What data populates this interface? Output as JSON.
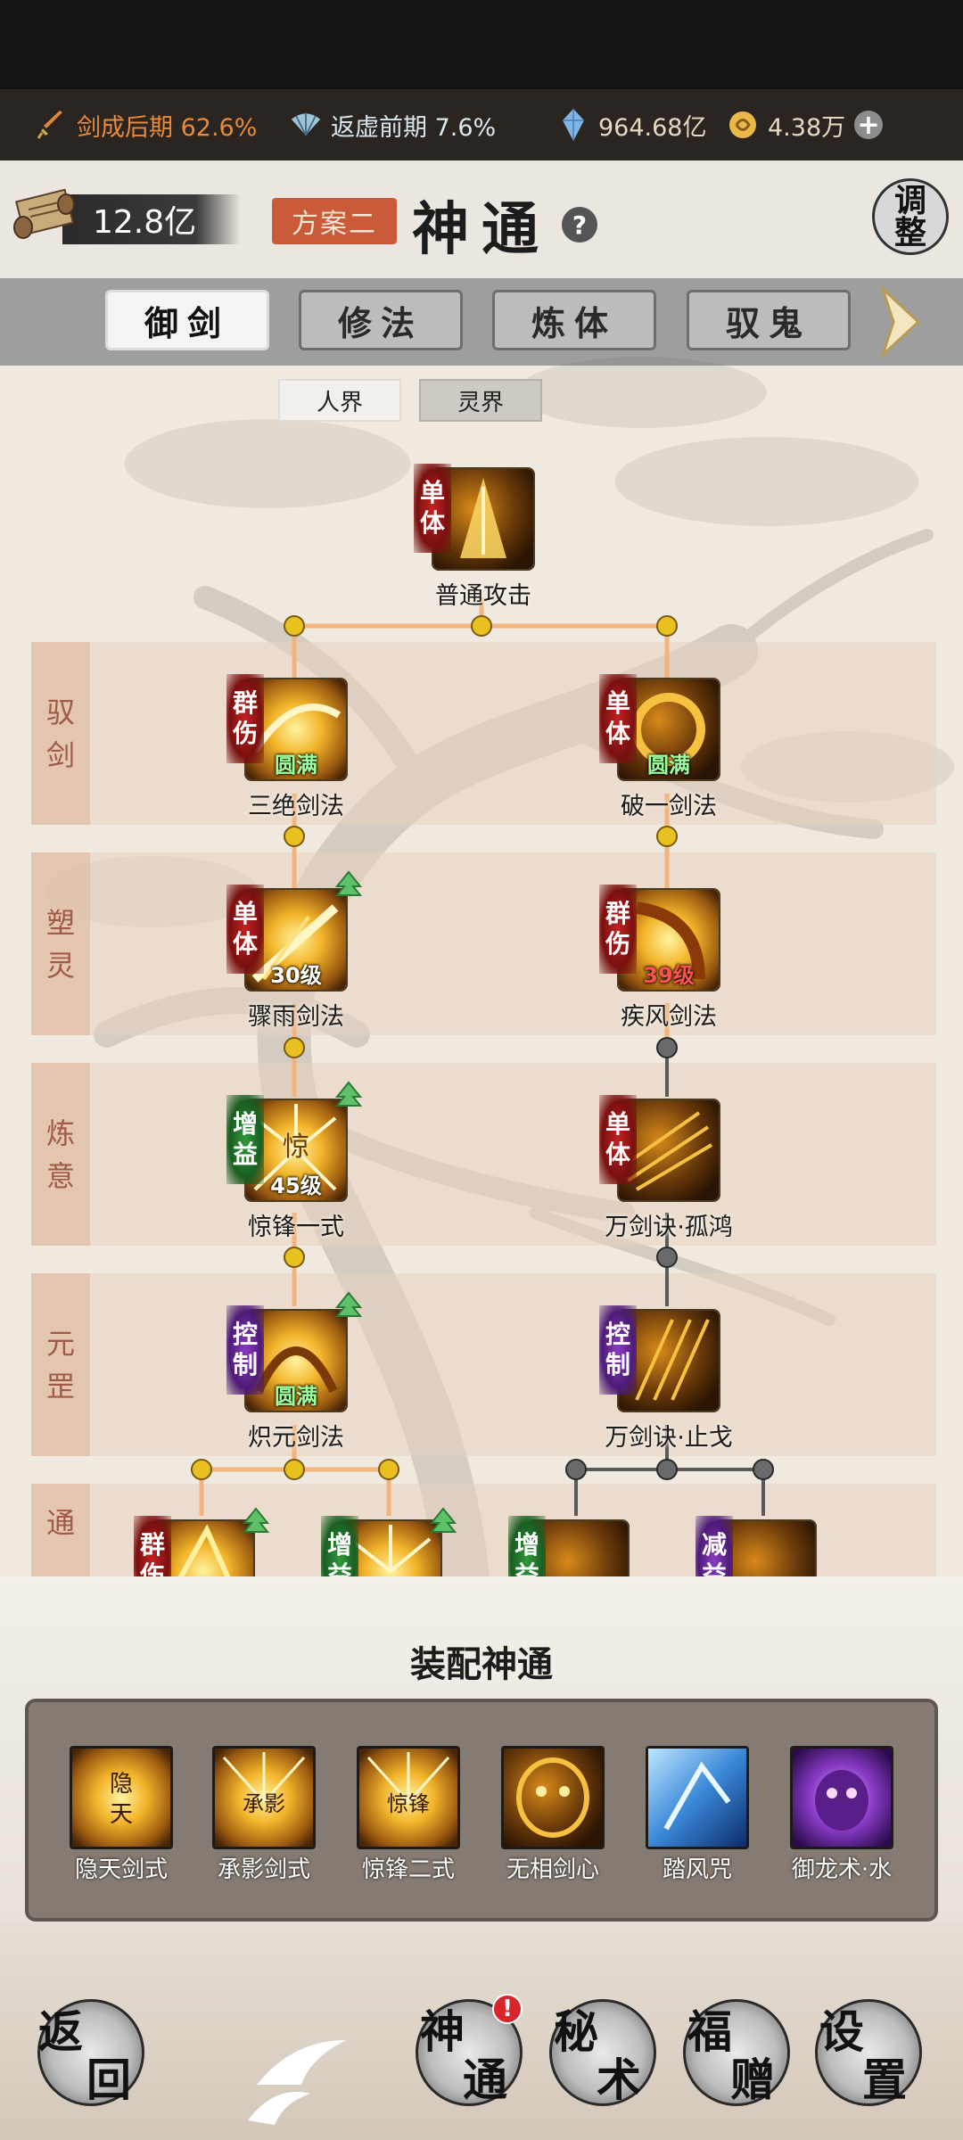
{
  "resources": {
    "cultivation_a": "剑成后期 62.6%",
    "cultivation_b": "返虚前期 7.6%",
    "spirit_stones": "964.68亿",
    "gold": "4.38万"
  },
  "header": {
    "power": "12.8亿",
    "plan": "方案二",
    "title": "神通",
    "help": "?",
    "adjust_line1": "调",
    "adjust_line2": "整"
  },
  "categories": [
    "御剑",
    "修法",
    "炼体",
    "驭鬼"
  ],
  "realms": [
    "人界",
    "灵界"
  ],
  "tiers": [
    {
      "c1": "驭",
      "c2": "剑"
    },
    {
      "c1": "塑",
      "c2": "灵"
    },
    {
      "c1": "炼",
      "c2": "意"
    },
    {
      "c1": "元",
      "c2": "罡"
    },
    {
      "c1": "通",
      "c2": ""
    }
  ],
  "skills": {
    "root": {
      "name": "普通攻击",
      "t1": "单",
      "t2": "体"
    },
    "s1": {
      "name": "三绝剑法",
      "t1": "群",
      "t2": "伤",
      "level": "圆满"
    },
    "s2": {
      "name": "破一剑法",
      "t1": "单",
      "t2": "体",
      "level": "圆满"
    },
    "s3": {
      "name": "骤雨剑法",
      "t1": "单",
      "t2": "体",
      "level": "30级"
    },
    "s4": {
      "name": "疾风剑法",
      "t1": "群",
      "t2": "伤",
      "level": "39级"
    },
    "s5": {
      "name": "惊锋一式",
      "t1": "增",
      "t2": "益",
      "level": "45级"
    },
    "s6": {
      "name": "万剑诀·孤鸿",
      "t1": "单",
      "t2": "体"
    },
    "s7": {
      "name": "炽元剑法",
      "t1": "控",
      "t2": "制",
      "level": "圆满"
    },
    "s8": {
      "name": "万剑诀·止戈",
      "t1": "控",
      "t2": "制"
    },
    "b1": {
      "t1": "群",
      "t2": "伤"
    },
    "b2": {
      "t1": "增",
      "t2": "益"
    },
    "b3": {
      "t1": "增",
      "t2": "益"
    },
    "b4": {
      "t1": "减",
      "t2": "益"
    }
  },
  "equip": {
    "title": "装配神通",
    "items": [
      "隐天剑式",
      "承影剑式",
      "惊锋二式",
      "无相剑心",
      "踏风咒",
      "御龙术·水"
    ]
  },
  "nav": {
    "back1": "返",
    "back2": "回",
    "shentong1": "神",
    "shentong2": "通",
    "mishu1": "秘",
    "mishu2": "术",
    "fuzeng1": "福",
    "fuzeng2": "赠",
    "shezhi1": "设",
    "shezhi2": "置"
  },
  "colors": {
    "resource_bar": "#2b2521",
    "tab_bar": "#9e9e9e",
    "tier_bg": "#e8d2be",
    "plan_tag": "#c95a3a",
    "path_active": "#f0b070",
    "node_active": "#e8c020",
    "node_inactive": "#5a5a5a"
  }
}
